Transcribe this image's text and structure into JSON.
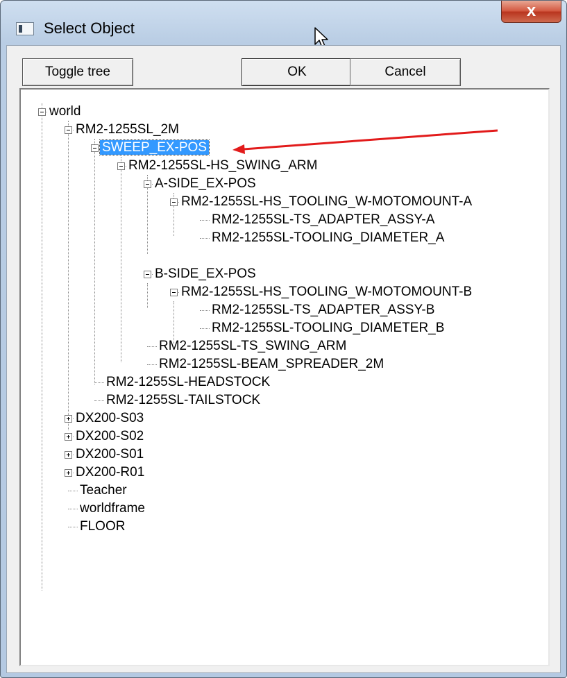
{
  "window": {
    "title": "Select Object",
    "close_glyph": "x"
  },
  "toolbar": {
    "toggle_label": "Toggle tree",
    "ok_label": "OK",
    "cancel_label": "Cancel"
  },
  "tree": {
    "world": "world",
    "rm2_root": "RM2-1255SL_2M",
    "sweep": "SWEEP_EX-POS",
    "hs_swing_arm": "RM2-1255SL-HS_SWING_ARM",
    "a_side": "A-SIDE_EX-POS",
    "hs_tooling_a": "RM2-1255SL-HS_TOOLING_W-MOTOMOUNT-A",
    "ts_adapter_a": "RM2-1255SL-TS_ADAPTER_ASSY-A",
    "tooling_diam_a": "RM2-1255SL-TOOLING_DIAMETER_A",
    "b_side": "B-SIDE_EX-POS",
    "hs_tooling_b": "RM2-1255SL-HS_TOOLING_W-MOTOMOUNT-B",
    "ts_adapter_b": "RM2-1255SL-TS_ADAPTER_ASSY-B",
    "tooling_diam_b": "RM2-1255SL-TOOLING_DIAMETER_B",
    "ts_swing_arm": "RM2-1255SL-TS_SWING_ARM",
    "beam_spreader": "RM2-1255SL-BEAM_SPREADER_2M",
    "headstock": "RM2-1255SL-HEADSTOCK",
    "tailstock": "RM2-1255SL-TAILSTOCK",
    "dx_s03": "DX200-S03",
    "dx_s02": "DX200-S02",
    "dx_s01": "DX200-S01",
    "dx_r01": "DX200-R01",
    "teacher": "Teacher",
    "worldframe": "worldframe",
    "floor": "FLOOR"
  },
  "colors": {
    "selection": "#3399ff",
    "annotation_arrow": "#e21b1b",
    "close_button": "#c8432b"
  },
  "icons": {
    "app": "window-icon",
    "close": "close-icon",
    "cursor": "mouse-pointer-icon",
    "expand": "plus-box-icon",
    "collapse": "minus-box-icon"
  }
}
